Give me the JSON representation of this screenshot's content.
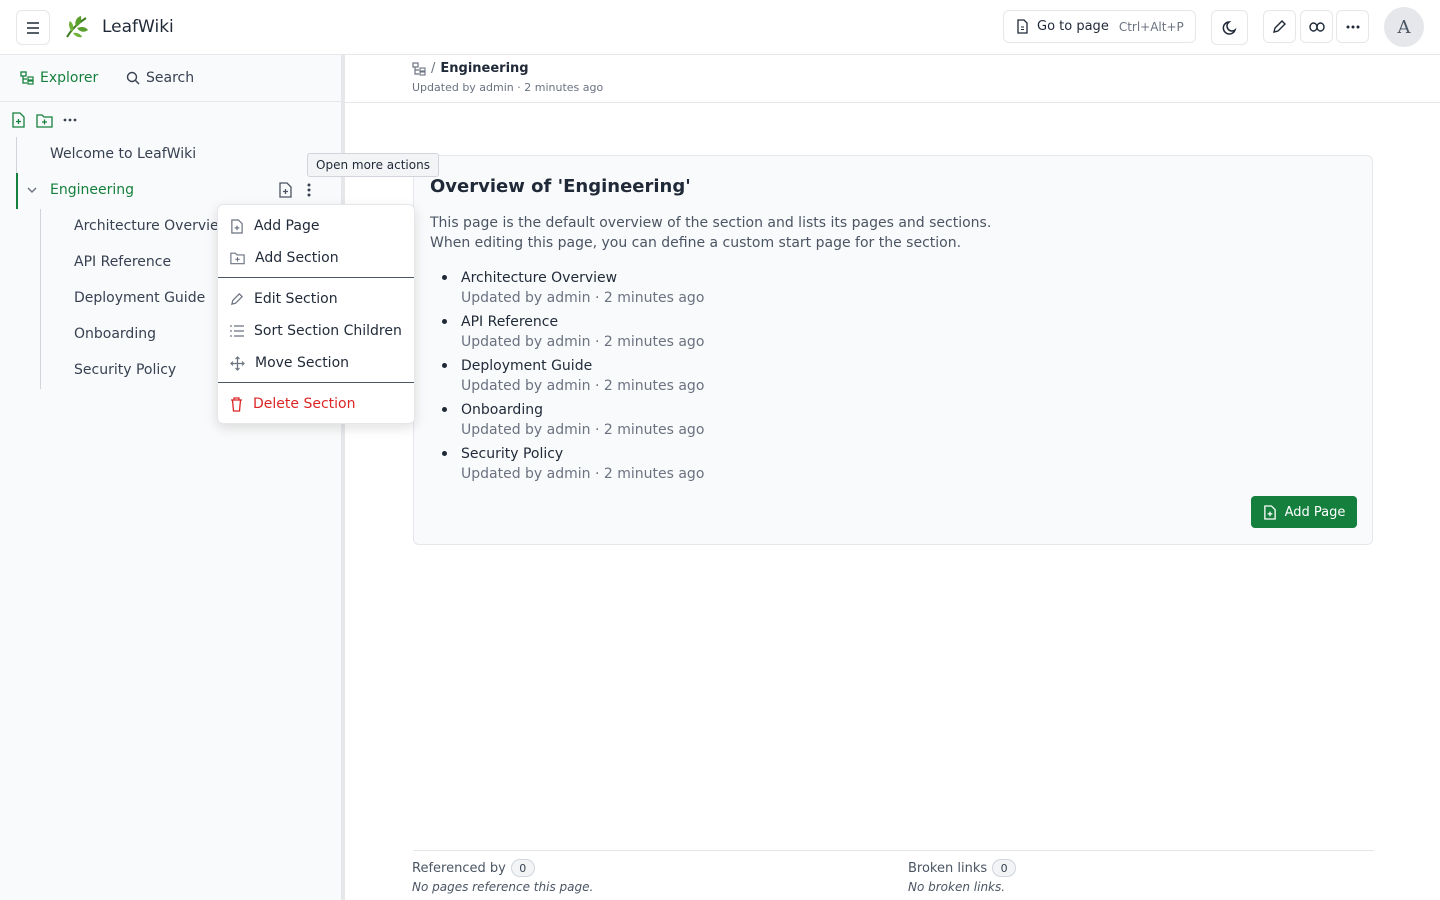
{
  "header": {
    "app_title": "LeafWiki",
    "goto_label": "Go to page",
    "goto_shortcut": "Ctrl+Alt+P",
    "avatar_initial": "A",
    "icons": [
      "menu-icon",
      "leaf-logo-icon",
      "file-icon",
      "moon-icon",
      "pencil-icon",
      "link-icon",
      "more-horizontal-icon"
    ]
  },
  "sidebar": {
    "tabs": [
      {
        "label": "Explorer",
        "icon": "tree-icon",
        "active": true
      },
      {
        "label": "Search",
        "icon": "search-icon",
        "active": false
      }
    ],
    "tree": {
      "root_items": [
        {
          "label": "Welcome to LeafWiki"
        },
        {
          "label": "Engineering",
          "expanded": true,
          "active": true
        }
      ],
      "children": [
        {
          "label": "Architecture Overview"
        },
        {
          "label": "API Reference"
        },
        {
          "label": "Deployment Guide"
        },
        {
          "label": "Onboarding"
        },
        {
          "label": "Security Policy"
        }
      ]
    }
  },
  "tooltip": {
    "text": "Open more actions"
  },
  "context_menu": {
    "items": [
      {
        "label": "Add Page",
        "icon": "file-plus-icon"
      },
      {
        "label": "Add Section",
        "icon": "folder-plus-icon"
      },
      {
        "label": "Edit Section",
        "icon": "pencil-icon"
      },
      {
        "label": "Sort Section Children",
        "icon": "list-icon"
      },
      {
        "label": "Move Section",
        "icon": "move-icon"
      },
      {
        "label": "Delete Section",
        "icon": "trash-icon",
        "danger": true
      }
    ]
  },
  "main": {
    "breadcrumb": {
      "current": "Engineering",
      "separator": "/"
    },
    "updated": "Updated by admin · 2 minutes ago",
    "card": {
      "title": "Overview of 'Engineering'",
      "description_line1": "This page is the default overview of the section and lists its pages and sections.",
      "description_line2": "When editing this page, you can define a custom start page for the section.",
      "pages": [
        {
          "name": "Architecture Overview",
          "meta": "Updated by admin · 2 minutes ago"
        },
        {
          "name": "API Reference",
          "meta": "Updated by admin · 2 minutes ago"
        },
        {
          "name": "Deployment Guide",
          "meta": "Updated by admin · 2 minutes ago"
        },
        {
          "name": "Onboarding",
          "meta": "Updated by admin · 2 minutes ago"
        },
        {
          "name": "Security Policy",
          "meta": "Updated by admin · 2 minutes ago"
        }
      ],
      "add_page_label": "Add Page"
    },
    "footer": {
      "referenced_by_label": "Referenced by",
      "referenced_by_count": "0",
      "referenced_by_note": "No pages reference this page.",
      "broken_links_label": "Broken links",
      "broken_links_count": "0",
      "broken_links_note": "No broken links."
    }
  },
  "colors": {
    "accent": "#15803d",
    "danger": "#dc2626"
  }
}
